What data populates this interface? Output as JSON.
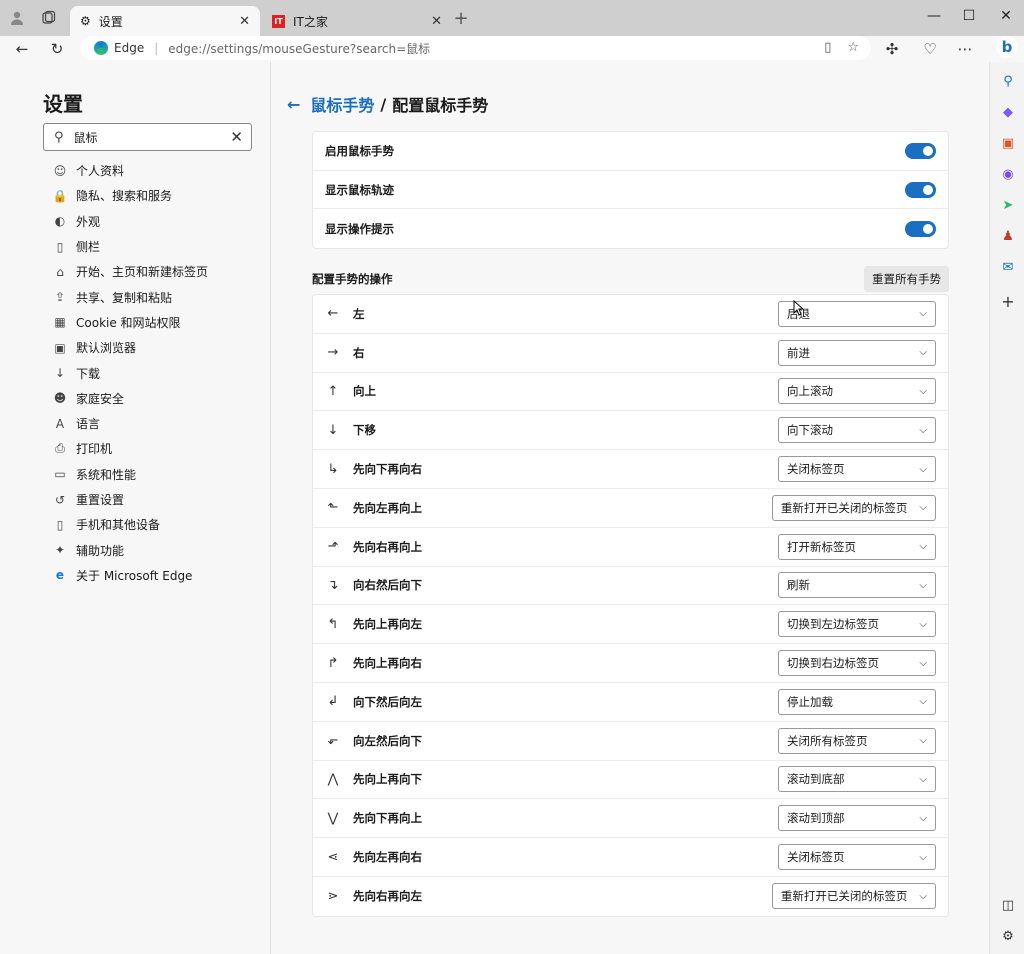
{
  "browser": {
    "tabs": [
      {
        "title": "设置",
        "icon": "gear-icon"
      },
      {
        "title": "IT之家",
        "icon": "ithome-logo-icon"
      }
    ],
    "omnibox": {
      "site_label": "Edge",
      "url": "edge://settings/mouseGesture?search=鼠标"
    }
  },
  "sidebar": {
    "title": "设置",
    "search_value": "鼠标",
    "items": [
      {
        "label": "个人资料",
        "icon": "profile-icon"
      },
      {
        "label": "隐私、搜索和服务",
        "icon": "lock-icon"
      },
      {
        "label": "外观",
        "icon": "palette-icon"
      },
      {
        "label": "侧栏",
        "icon": "sidebar-icon"
      },
      {
        "label": "开始、主页和新建标签页",
        "icon": "home-icon"
      },
      {
        "label": "共享、复制和粘贴",
        "icon": "share-icon"
      },
      {
        "label": "Cookie 和网站权限",
        "icon": "cookie-icon"
      },
      {
        "label": "默认浏览器",
        "icon": "browser-icon"
      },
      {
        "label": "下载",
        "icon": "download-icon"
      },
      {
        "label": "家庭安全",
        "icon": "family-icon"
      },
      {
        "label": "语言",
        "icon": "language-icon"
      },
      {
        "label": "打印机",
        "icon": "printer-icon"
      },
      {
        "label": "系统和性能",
        "icon": "laptop-icon"
      },
      {
        "label": "重置设置",
        "icon": "reset-icon"
      },
      {
        "label": "手机和其他设备",
        "icon": "phone-icon"
      },
      {
        "label": "辅助功能",
        "icon": "accessibility-icon"
      },
      {
        "label": "关于 Microsoft Edge",
        "icon": "edge-logo-icon"
      }
    ]
  },
  "main": {
    "breadcrumb_parent": "鼠标手势",
    "breadcrumb_sep": "/",
    "breadcrumb_current": "配置鼠标手势",
    "toggles": [
      {
        "label": "启用鼠标手势"
      },
      {
        "label": "显示鼠标轨迹"
      },
      {
        "label": "显示操作提示"
      }
    ],
    "section_title": "配置手势的操作",
    "reset_label": "重置所有手势",
    "gestures": [
      {
        "label": "左",
        "value": "后退",
        "icon": "arrow-left-icon",
        "glyph": "←"
      },
      {
        "label": "右",
        "value": "前进",
        "icon": "arrow-right-icon",
        "glyph": "→"
      },
      {
        "label": "向上",
        "value": "向上滚动",
        "icon": "arrow-up-icon",
        "glyph": "↑"
      },
      {
        "label": "下移",
        "value": "向下滚动",
        "icon": "arrow-down-icon",
        "glyph": "↓"
      },
      {
        "label": "先向下再向右",
        "value": "关闭标签页",
        "icon": "down-right-icon",
        "glyph": "↳"
      },
      {
        "label": "先向左再向上",
        "value": "重新打开已关闭的标签页",
        "icon": "left-up-icon",
        "glyph": "⬑"
      },
      {
        "label": "先向右再向上",
        "value": "打开新标签页",
        "icon": "right-up-icon",
        "glyph": "⬏"
      },
      {
        "label": "向右然后向下",
        "value": "刷新",
        "icon": "right-down-icon",
        "glyph": "↴"
      },
      {
        "label": "先向上再向左",
        "value": "切换到左边标签页",
        "icon": "up-left-icon",
        "glyph": "↰"
      },
      {
        "label": "先向上再向右",
        "value": "切换到右边标签页",
        "icon": "up-right-icon",
        "glyph": "↱"
      },
      {
        "label": "向下然后向左",
        "value": "停止加载",
        "icon": "down-left-icon",
        "glyph": "↲"
      },
      {
        "label": "向左然后向下",
        "value": "关闭所有标签页",
        "icon": "left-down-icon",
        "glyph": "⬐"
      },
      {
        "label": "先向上再向下",
        "value": "滚动到底部",
        "icon": "up-down-icon",
        "glyph": "⋀"
      },
      {
        "label": "先向下再向上",
        "value": "滚动到顶部",
        "icon": "down-up-icon",
        "glyph": "⋁"
      },
      {
        "label": "先向左再向右",
        "value": "关闭标签页",
        "icon": "left-right-icon",
        "glyph": "⋖"
      },
      {
        "label": "先向右再向左",
        "value": "重新打开已关闭的标签页",
        "icon": "right-left-icon",
        "glyph": "⋗"
      }
    ]
  },
  "colors": {
    "accent": "#1b6fc0"
  }
}
